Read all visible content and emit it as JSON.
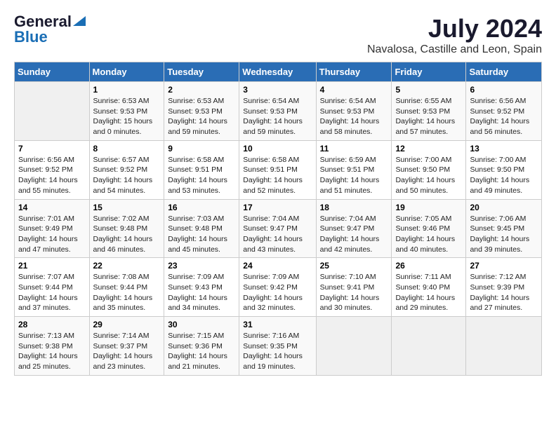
{
  "logo": {
    "general": "General",
    "blue": "Blue"
  },
  "title": "July 2024",
  "location": "Navalosa, Castille and Leon, Spain",
  "days_header": [
    "Sunday",
    "Monday",
    "Tuesday",
    "Wednesday",
    "Thursday",
    "Friday",
    "Saturday"
  ],
  "weeks": [
    [
      {
        "day": "",
        "info": ""
      },
      {
        "day": "1",
        "info": "Sunrise: 6:53 AM\nSunset: 9:53 PM\nDaylight: 15 hours\nand 0 minutes."
      },
      {
        "day": "2",
        "info": "Sunrise: 6:53 AM\nSunset: 9:53 PM\nDaylight: 14 hours\nand 59 minutes."
      },
      {
        "day": "3",
        "info": "Sunrise: 6:54 AM\nSunset: 9:53 PM\nDaylight: 14 hours\nand 59 minutes."
      },
      {
        "day": "4",
        "info": "Sunrise: 6:54 AM\nSunset: 9:53 PM\nDaylight: 14 hours\nand 58 minutes."
      },
      {
        "day": "5",
        "info": "Sunrise: 6:55 AM\nSunset: 9:53 PM\nDaylight: 14 hours\nand 57 minutes."
      },
      {
        "day": "6",
        "info": "Sunrise: 6:56 AM\nSunset: 9:52 PM\nDaylight: 14 hours\nand 56 minutes."
      }
    ],
    [
      {
        "day": "7",
        "info": "Sunrise: 6:56 AM\nSunset: 9:52 PM\nDaylight: 14 hours\nand 55 minutes."
      },
      {
        "day": "8",
        "info": "Sunrise: 6:57 AM\nSunset: 9:52 PM\nDaylight: 14 hours\nand 54 minutes."
      },
      {
        "day": "9",
        "info": "Sunrise: 6:58 AM\nSunset: 9:51 PM\nDaylight: 14 hours\nand 53 minutes."
      },
      {
        "day": "10",
        "info": "Sunrise: 6:58 AM\nSunset: 9:51 PM\nDaylight: 14 hours\nand 52 minutes."
      },
      {
        "day": "11",
        "info": "Sunrise: 6:59 AM\nSunset: 9:51 PM\nDaylight: 14 hours\nand 51 minutes."
      },
      {
        "day": "12",
        "info": "Sunrise: 7:00 AM\nSunset: 9:50 PM\nDaylight: 14 hours\nand 50 minutes."
      },
      {
        "day": "13",
        "info": "Sunrise: 7:00 AM\nSunset: 9:50 PM\nDaylight: 14 hours\nand 49 minutes."
      }
    ],
    [
      {
        "day": "14",
        "info": "Sunrise: 7:01 AM\nSunset: 9:49 PM\nDaylight: 14 hours\nand 47 minutes."
      },
      {
        "day": "15",
        "info": "Sunrise: 7:02 AM\nSunset: 9:48 PM\nDaylight: 14 hours\nand 46 minutes."
      },
      {
        "day": "16",
        "info": "Sunrise: 7:03 AM\nSunset: 9:48 PM\nDaylight: 14 hours\nand 45 minutes."
      },
      {
        "day": "17",
        "info": "Sunrise: 7:04 AM\nSunset: 9:47 PM\nDaylight: 14 hours\nand 43 minutes."
      },
      {
        "day": "18",
        "info": "Sunrise: 7:04 AM\nSunset: 9:47 PM\nDaylight: 14 hours\nand 42 minutes."
      },
      {
        "day": "19",
        "info": "Sunrise: 7:05 AM\nSunset: 9:46 PM\nDaylight: 14 hours\nand 40 minutes."
      },
      {
        "day": "20",
        "info": "Sunrise: 7:06 AM\nSunset: 9:45 PM\nDaylight: 14 hours\nand 39 minutes."
      }
    ],
    [
      {
        "day": "21",
        "info": "Sunrise: 7:07 AM\nSunset: 9:44 PM\nDaylight: 14 hours\nand 37 minutes."
      },
      {
        "day": "22",
        "info": "Sunrise: 7:08 AM\nSunset: 9:44 PM\nDaylight: 14 hours\nand 35 minutes."
      },
      {
        "day": "23",
        "info": "Sunrise: 7:09 AM\nSunset: 9:43 PM\nDaylight: 14 hours\nand 34 minutes."
      },
      {
        "day": "24",
        "info": "Sunrise: 7:09 AM\nSunset: 9:42 PM\nDaylight: 14 hours\nand 32 minutes."
      },
      {
        "day": "25",
        "info": "Sunrise: 7:10 AM\nSunset: 9:41 PM\nDaylight: 14 hours\nand 30 minutes."
      },
      {
        "day": "26",
        "info": "Sunrise: 7:11 AM\nSunset: 9:40 PM\nDaylight: 14 hours\nand 29 minutes."
      },
      {
        "day": "27",
        "info": "Sunrise: 7:12 AM\nSunset: 9:39 PM\nDaylight: 14 hours\nand 27 minutes."
      }
    ],
    [
      {
        "day": "28",
        "info": "Sunrise: 7:13 AM\nSunset: 9:38 PM\nDaylight: 14 hours\nand 25 minutes."
      },
      {
        "day": "29",
        "info": "Sunrise: 7:14 AM\nSunset: 9:37 PM\nDaylight: 14 hours\nand 23 minutes."
      },
      {
        "day": "30",
        "info": "Sunrise: 7:15 AM\nSunset: 9:36 PM\nDaylight: 14 hours\nand 21 minutes."
      },
      {
        "day": "31",
        "info": "Sunrise: 7:16 AM\nSunset: 9:35 PM\nDaylight: 14 hours\nand 19 minutes."
      },
      {
        "day": "",
        "info": ""
      },
      {
        "day": "",
        "info": ""
      },
      {
        "day": "",
        "info": ""
      }
    ]
  ]
}
